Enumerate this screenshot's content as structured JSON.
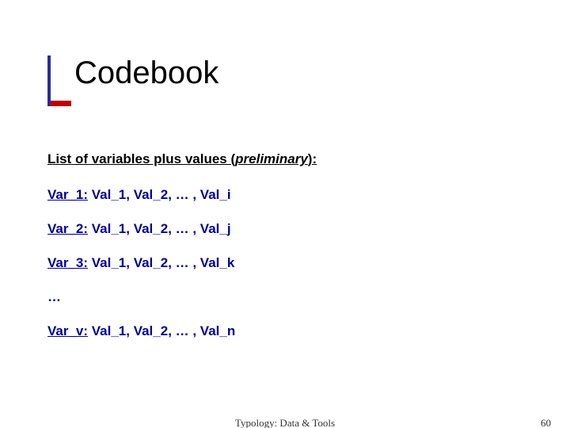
{
  "title": "Codebook",
  "subhead_prefix": "List of variables plus values (",
  "subhead_italic": "preliminary",
  "subhead_suffix": "):",
  "rows": [
    {
      "label": "Var_1:",
      "vals": " Val_1, Val_2, … , Val_i"
    },
    {
      "label": "Var_2:",
      "vals": " Val_1, Val_2, … , Val_j"
    },
    {
      "label": "Var_3:",
      "vals": " Val_1, Val_2, … , Val_k"
    }
  ],
  "ellipsis": "…",
  "last_row": {
    "label": "Var_v:",
    "vals": " Val_1, Val_2, … , Val_n"
  },
  "footer_center": "Typology: Data & Tools",
  "footer_page": "60"
}
